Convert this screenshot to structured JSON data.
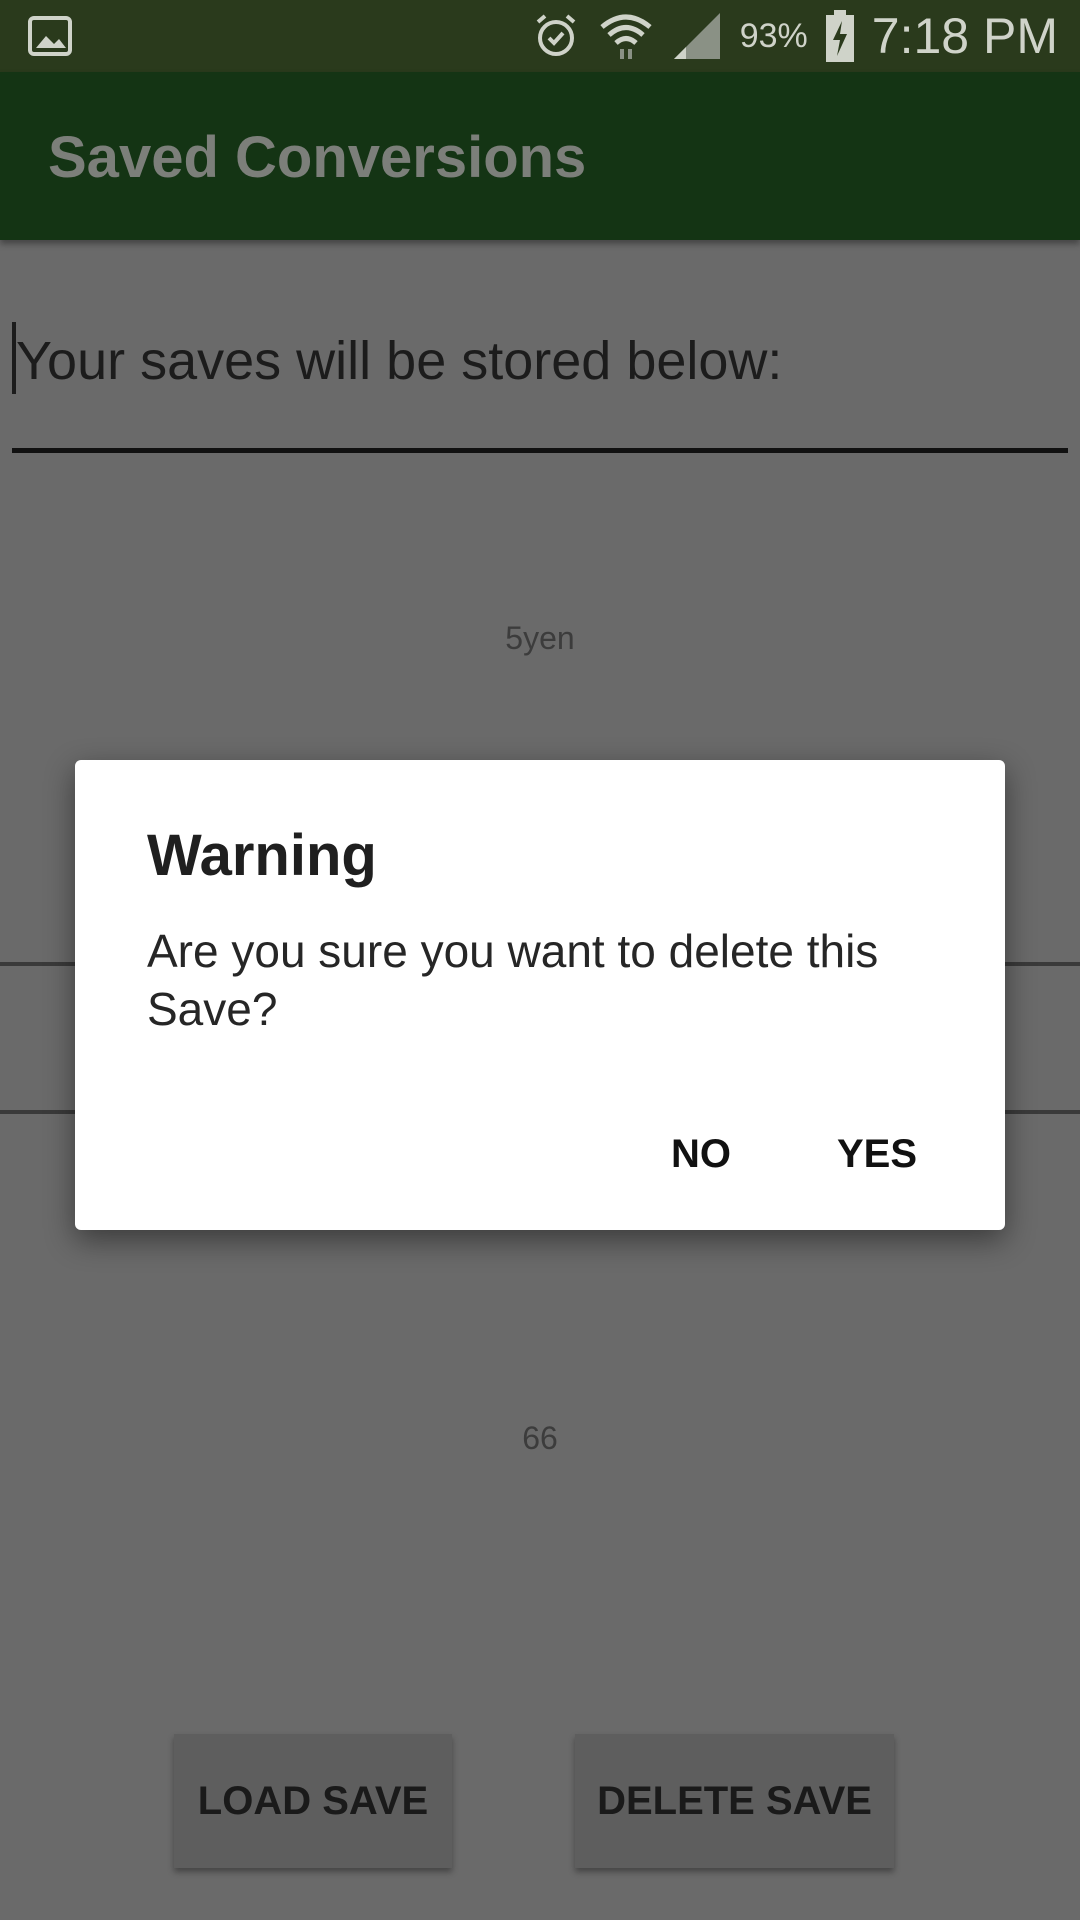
{
  "status_bar": {
    "battery": "93%",
    "time": "7:18 PM",
    "icons": [
      "gallery-icon",
      "alarm-icon",
      "wifi-icon",
      "signal-icon",
      "battery-charging-icon"
    ]
  },
  "app_bar": {
    "title": "Saved Conversions"
  },
  "header": {
    "text": "Your saves will be stored below:"
  },
  "saves_list": {
    "items": [
      "5yen",
      "66"
    ]
  },
  "buttons": {
    "load": "LOAD SAVE",
    "delete": "DELETE SAVE"
  },
  "dialog": {
    "title": "Warning",
    "message": "Are you sure you want to delete this Save?",
    "no": "NO",
    "yes": "YES"
  },
  "colors": {
    "status_bar": "#2a3a1c",
    "app_bar": "#143414",
    "scrim_background": "#6a6a6a",
    "dialog": "#ffffff"
  }
}
